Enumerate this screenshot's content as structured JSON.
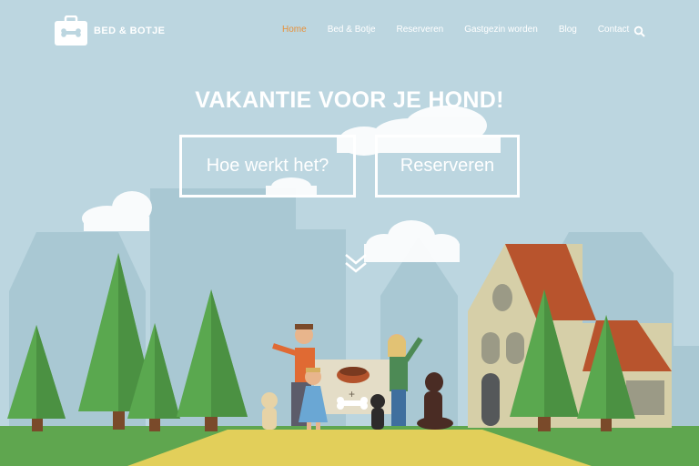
{
  "header": {
    "logo_text": "BED & BOTJE",
    "nav": [
      {
        "label": "Home",
        "active": true
      },
      {
        "label": "Bed & Botje",
        "active": false
      },
      {
        "label": "Reserveren",
        "active": false
      },
      {
        "label": "Gastgezin worden",
        "active": false
      },
      {
        "label": "Blog",
        "active": false
      },
      {
        "label": "Contact",
        "active": false
      }
    ],
    "search_icon": "search-icon"
  },
  "hero": {
    "title": "VAKANTIE VOOR JE HOND!",
    "buttons": {
      "how_it_works": "Hoe werkt het?",
      "reserve": "Reserveren"
    },
    "scroll_icon": "double-chevron-down-icon"
  },
  "colors": {
    "sky": "#bcd6e0",
    "accent": "#e8913a",
    "grass": "#5fa64f",
    "path": "#e2cf5a",
    "tree": "#4e9c47",
    "roof": "#b8542d"
  }
}
